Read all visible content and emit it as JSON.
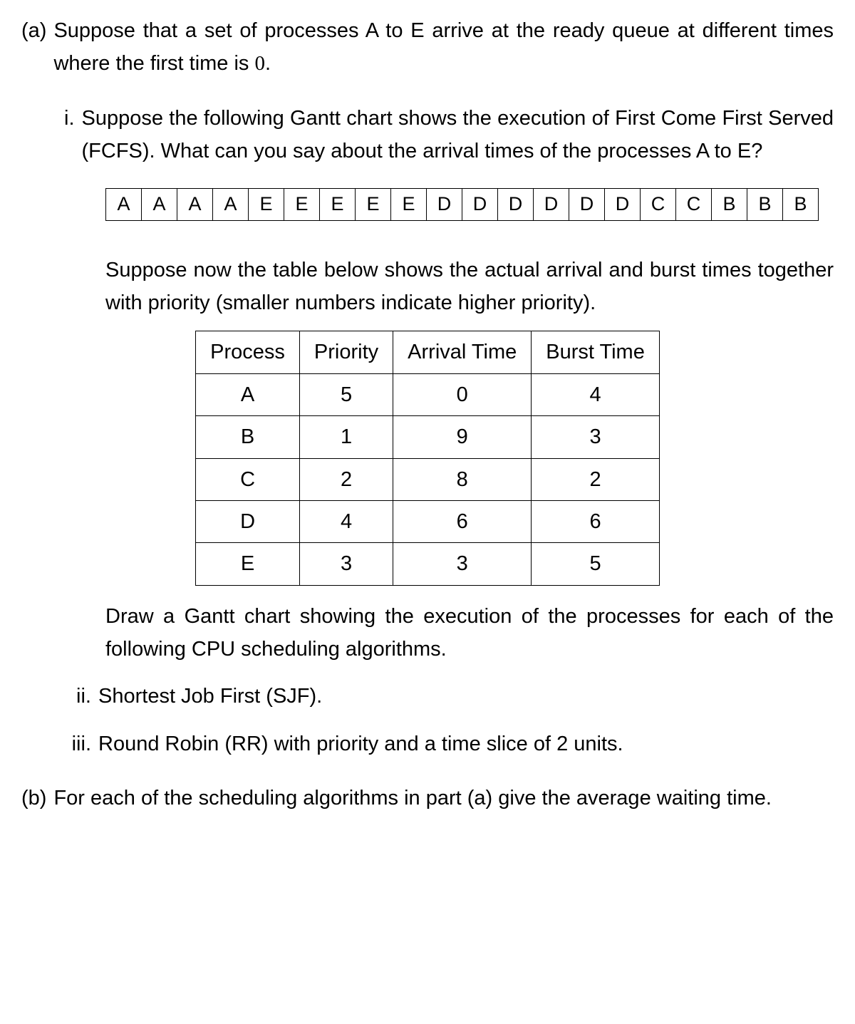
{
  "labels": {
    "a": "(a)",
    "i": "i.",
    "ii": "ii.",
    "iii": "iii.",
    "b": "(b)"
  },
  "a_intro_1": "Suppose that a set of processes A to E arrive at the ready queue at different",
  "a_intro_2": "times where the first time is ",
  "a_intro_zero": "0",
  "a_intro_period": ".",
  "i_1": "Suppose the following Gantt chart shows the execution of First Come",
  "i_2": "First Served (FCFS). What can you say about the arrival times of the",
  "i_3": "processes A to E?",
  "gantt_cells": [
    "A",
    "A",
    "A",
    "A",
    "E",
    "E",
    "E",
    "E",
    "E",
    "D",
    "D",
    "D",
    "D",
    "D",
    "D",
    "C",
    "C",
    "B",
    "B",
    "B"
  ],
  "mid_1": "Suppose now the table below shows the actual arrival and burst times",
  "mid_2": "together with priority (smaller numbers indicate higher priority).",
  "table": {
    "headers": [
      "Process",
      "Priority",
      "Arrival Time",
      "Burst Time"
    ],
    "rows": [
      [
        "A",
        "5",
        "0",
        "4"
      ],
      [
        "B",
        "1",
        "9",
        "3"
      ],
      [
        "C",
        "2",
        "8",
        "2"
      ],
      [
        "D",
        "4",
        "6",
        "6"
      ],
      [
        "E",
        "3",
        "3",
        "5"
      ]
    ]
  },
  "draw_1": "Draw a Gantt chart showing the execution of the processes for each",
  "draw_2": "of the following CPU scheduling algorithms.",
  "ii_text": "Shortest Job First (SJF).",
  "iii_text": "Round Robin (RR) with priority and a time slice of 2 units.",
  "b_1": "For each of the scheduling algorithms in part (a) give the average waiting",
  "b_2": "time.",
  "chart_data": {
    "type": "table",
    "title": "Process attributes",
    "columns": [
      "Process",
      "Priority",
      "Arrival Time",
      "Burst Time"
    ],
    "rows": [
      {
        "Process": "A",
        "Priority": 5,
        "Arrival Time": 0,
        "Burst Time": 4
      },
      {
        "Process": "B",
        "Priority": 1,
        "Arrival Time": 9,
        "Burst Time": 3
      },
      {
        "Process": "C",
        "Priority": 2,
        "Arrival Time": 8,
        "Burst Time": 2
      },
      {
        "Process": "D",
        "Priority": 4,
        "Arrival Time": 6,
        "Burst Time": 6
      },
      {
        "Process": "E",
        "Priority": 3,
        "Arrival Time": 3,
        "Burst Time": 5
      }
    ]
  }
}
